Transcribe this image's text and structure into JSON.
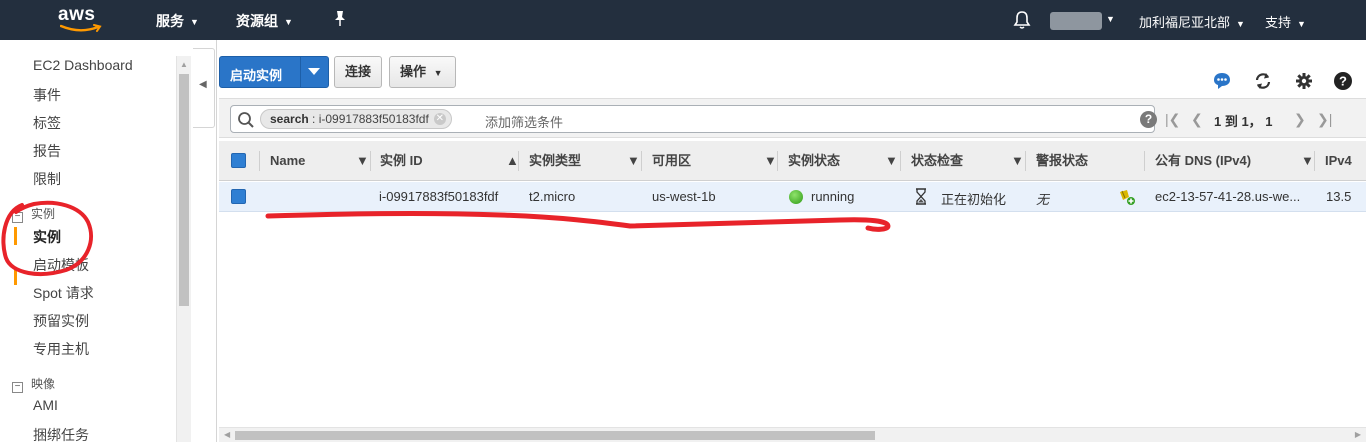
{
  "topnav": {
    "logo": "aws",
    "services": "服务",
    "resource_groups": "资源组",
    "region": "加利福尼亚北部",
    "support": "支持",
    "icons": [
      "pin-icon",
      "bell-icon"
    ]
  },
  "sidebar": {
    "items_top": [
      "EC2 Dashboard",
      "事件",
      "标签",
      "报告",
      "限制"
    ],
    "section_instances": "实例",
    "instances_items": [
      "实例",
      "启动模板",
      "Spot 请求",
      "预留实例",
      "专用主机"
    ],
    "section_images": "映像",
    "images_items": [
      "AMI",
      "捆绑任务"
    ]
  },
  "toolbar": {
    "launch_label": "启动实例",
    "connect_label": "连接",
    "actions_label": "操作",
    "icons": [
      "chat-icon",
      "refresh-icon",
      "settings-icon",
      "help-icon"
    ]
  },
  "filter": {
    "token_key": "search",
    "token_value": "i-09917883f50183fdf",
    "placeholder": "添加筛选条件",
    "pagination": "1 到 1， 1"
  },
  "table": {
    "columns": [
      "Name",
      "实例 ID",
      "实例类型",
      "可用区",
      "实例状态",
      "状态检查",
      "警报状态",
      "公有 DNS (IPv4)",
      "IPv4"
    ],
    "rows": [
      {
        "name": "",
        "instance_id": "i-09917883f50183fdf",
        "type": "t2.micro",
        "zone": "us-west-1b",
        "state": "running",
        "status_check": "正在初始化",
        "alarm": "无",
        "dns": "ec2-13-57-41-28.us-we...",
        "ipv4": "13.5"
      }
    ]
  },
  "colors": {
    "nav_bg": "#232f3e",
    "primary_button": "#2a75c8",
    "active_accent": "#ff9900",
    "annotation_red": "#e8232a"
  }
}
